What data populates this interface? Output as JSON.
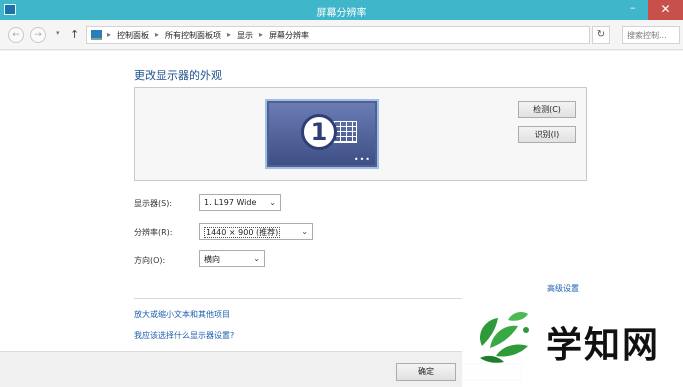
{
  "window": {
    "title": "屏幕分辨率",
    "minimize_glyph": "–",
    "close_glyph": "✕"
  },
  "nav": {
    "back_glyph": "←",
    "forward_glyph": "→",
    "recent_glyph": "▾",
    "up_glyph": "↑",
    "breadcrumbs": [
      "控制面板",
      "所有控制面板项",
      "显示",
      "屏幕分辨率"
    ],
    "separator": "▸",
    "dropdown_glyph": "⌄",
    "refresh_glyph": "↻",
    "search_placeholder": "搜索控制..."
  },
  "main": {
    "heading": "更改显示器的外观",
    "monitor_number": "1",
    "monitor_dots": "•••",
    "detect_button": "检测(C)",
    "identify_button": "识别(I)",
    "display_label": "显示器(S):",
    "display_value": "1. L197 Wide",
    "resolution_label": "分辨率(R):",
    "resolution_value": "1440 × 900 (推荐)",
    "orientation_label": "方向(O):",
    "orientation_value": "横向",
    "advanced_link": "高级设置",
    "link_text_size": "放大或缩小文本和其他项目",
    "link_which_settings": "我应该选择什么显示器设置?"
  },
  "footer": {
    "ok_button": "确定"
  },
  "watermark": {
    "text": "学知网"
  },
  "colors": {
    "titlebar": "#3fb6c9",
    "close": "#c7514a",
    "link": "#1e5fb0",
    "heading": "#1e4e8c",
    "logo_green": "#2e9a3a"
  }
}
